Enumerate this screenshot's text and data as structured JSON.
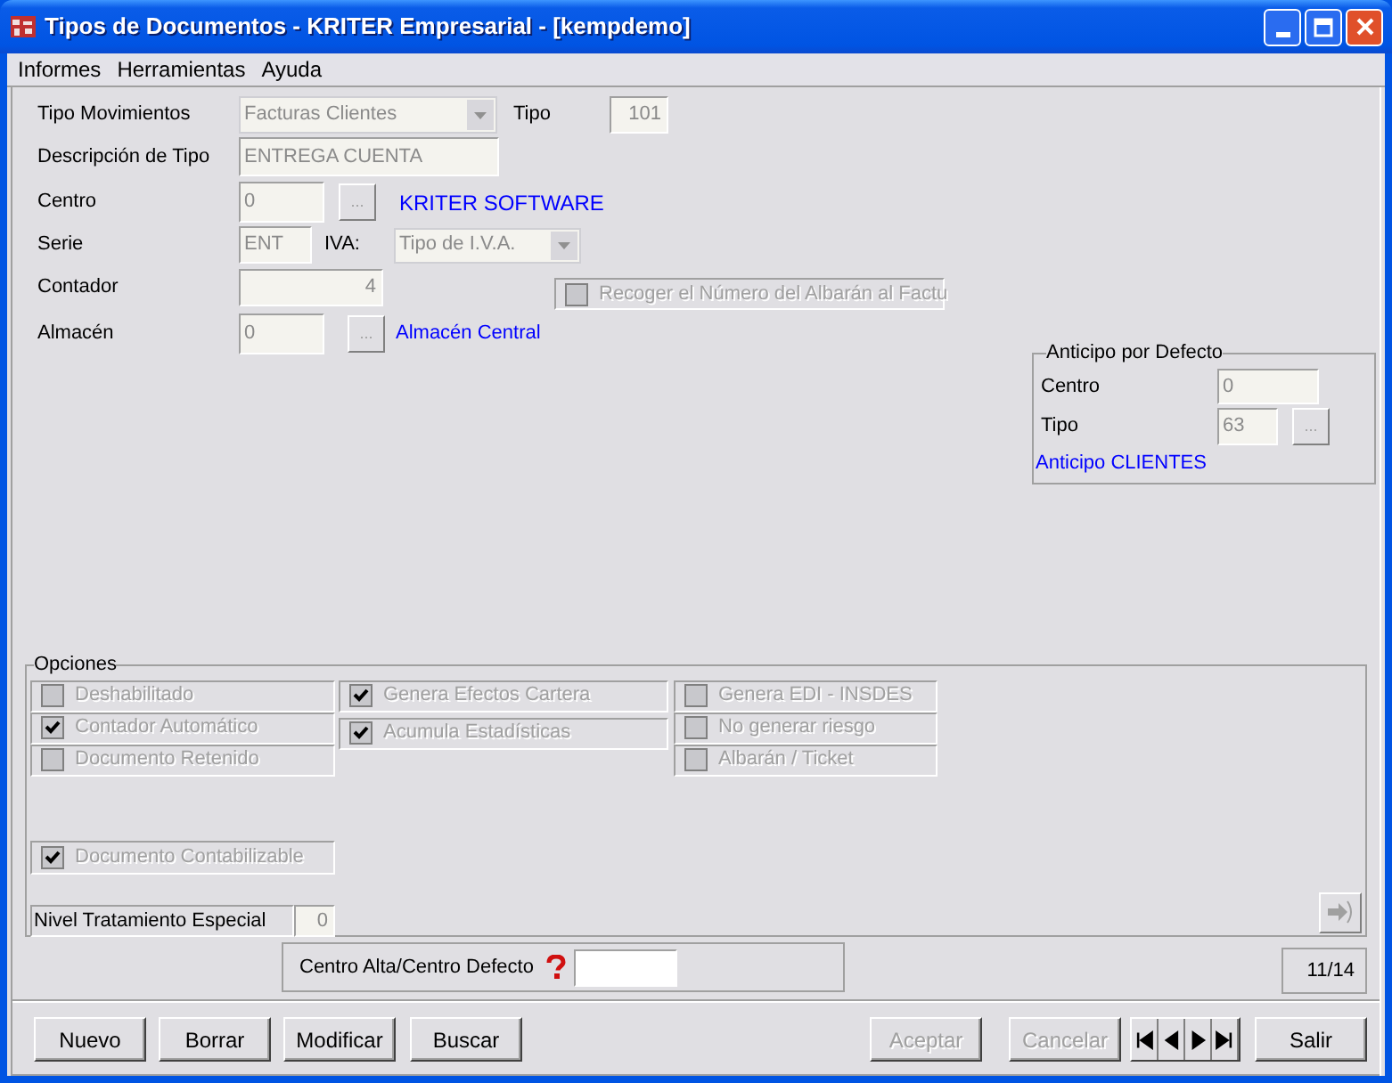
{
  "window": {
    "title": "Tipos de Documentos - KRITER Empresarial - [kempdemo]"
  },
  "menu": [
    {
      "label": "Informes"
    },
    {
      "label": "Herramientas"
    },
    {
      "label": "Ayuda"
    }
  ],
  "form": {
    "tipo_movimientos": {
      "label": "Tipo Movimientos",
      "value": "Facturas Clientes"
    },
    "tipo": {
      "label": "Tipo",
      "value": "101"
    },
    "descripcion": {
      "label": "Descripción de Tipo",
      "value": "ENTREGA CUENTA"
    },
    "centro": {
      "label": "Centro",
      "value": "0",
      "button": "...",
      "info": "KRITER SOFTWARE"
    },
    "serie": {
      "label": "Serie",
      "value": "ENT"
    },
    "iva": {
      "label": "IVA:",
      "value": "Tipo de I.V.A."
    },
    "contador": {
      "label": "Contador",
      "value": "4"
    },
    "recoger": {
      "label": "Recoger el Número del Albarán al Factu",
      "checked": false,
      "disabled": true
    },
    "almacen": {
      "label": "Almacén",
      "value": "0",
      "button": "...",
      "info": "Almacén Central"
    }
  },
  "anticipo": {
    "title": "Anticipo por Defecto",
    "centro": {
      "label": "Centro",
      "value": "0"
    },
    "tipo": {
      "label": "Tipo",
      "value": "63",
      "button": "..."
    },
    "info": "Anticipo CLIENTES"
  },
  "opciones": {
    "title": "Opciones",
    "columns": [
      [
        {
          "label": "Deshabilitado",
          "checked": false,
          "disabled": true
        },
        {
          "label": "Contador Automático",
          "checked": true,
          "disabled": true
        },
        {
          "label": "Documento Retenido",
          "checked": false,
          "disabled": true
        }
      ],
      [
        {
          "label": "Genera Efectos Cartera",
          "checked": true,
          "disabled": true
        },
        {
          "label": "Acumula Estadísticas",
          "checked": true,
          "disabled": true
        }
      ],
      [
        {
          "label": "Genera EDI - INSDES",
          "checked": false,
          "disabled": true
        },
        {
          "label": "No generar riesgo",
          "checked": false,
          "disabled": true
        },
        {
          "label": "Albarán / Ticket",
          "checked": false,
          "disabled": true
        }
      ]
    ],
    "contabilizable": {
      "label": "Documento Contabilizable",
      "checked": true,
      "disabled": true
    },
    "nivel": {
      "label": "Nivel Tratamiento Especial",
      "value": "0"
    }
  },
  "centro_alta": {
    "label": "Centro Alta/Centro Defecto"
  },
  "record_position": "11/14",
  "buttons": [
    {
      "label": "Nuevo",
      "disabled": false
    },
    {
      "label": "Borrar",
      "disabled": false
    },
    {
      "label": "Modificar",
      "disabled": false
    },
    {
      "label": "Buscar",
      "disabled": false
    },
    {
      "label": "Aceptar",
      "disabled": true
    },
    {
      "label": "Cancelar",
      "disabled": true
    },
    {
      "label": "Salir",
      "disabled": false
    }
  ]
}
